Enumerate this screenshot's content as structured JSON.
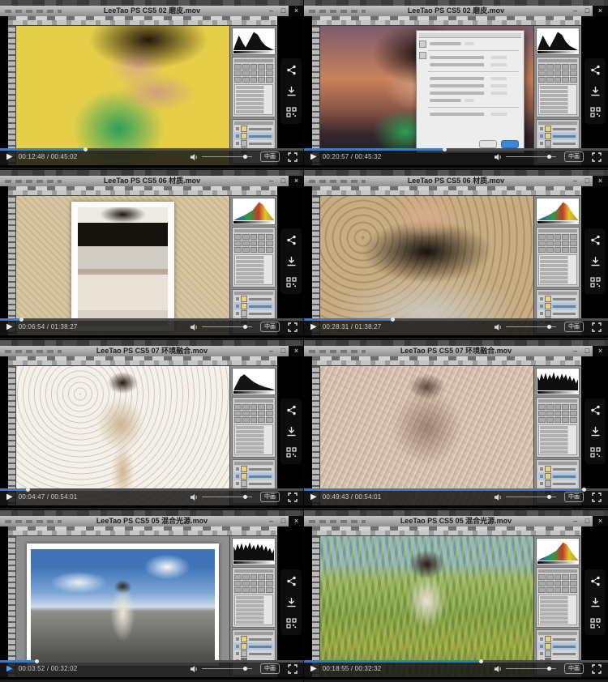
{
  "page": {
    "background": "#121212"
  },
  "player": {
    "accent_color": "#2f7fd6",
    "quality_label": "中画",
    "window_controls": {
      "minimize": "–",
      "maximize": "□",
      "close": "×"
    },
    "overlay_icons": [
      "share-icon",
      "download-icon",
      "qrcode-icon"
    ],
    "control_icons": [
      "play-icon",
      "volume-icon",
      "fullscreen-icon"
    ]
  },
  "cells": [
    {
      "title": "LeeTao PS CS5 02 磨皮.mov",
      "time_text": "00:12:48 / 00:45:02",
      "played_percent": 28,
      "histogram": "dark-peaks",
      "photo": "c1",
      "has_dialog": false
    },
    {
      "title": "LeeTao PS CS5 02 磨皮.mov",
      "time_text": "00:20:57 / 00:45:32",
      "played_percent": 46,
      "histogram": "dark-peaks",
      "photo": "c2",
      "has_dialog": true
    },
    {
      "title": "LeeTao PS CS5 06 材质.mov",
      "time_text": "00:06:54 / 01:38:27",
      "played_percent": 7,
      "histogram": "color-ramp",
      "photo": "c3",
      "has_dialog": false
    },
    {
      "title": "LeeTao PS CS5 06 材质.mov",
      "time_text": "00:28:31 / 01:38:27",
      "played_percent": 29,
      "histogram": "color-ramp",
      "photo": "c4",
      "has_dialog": false
    },
    {
      "title": "LeeTao PS CS5 07 环境融合.mov",
      "time_text": "00:04:47 / 00:54:01",
      "played_percent": 9,
      "histogram": "dark-mound",
      "photo": "c5",
      "has_dialog": false
    },
    {
      "title": "LeeTao PS CS5 07 环境融合.mov",
      "time_text": "00:49:43 / 00:54:01",
      "played_percent": 92,
      "histogram": "dark-comb",
      "photo": "c6",
      "has_dialog": false
    },
    {
      "title": "LeeTao PS CS5 05 混合光源.mov",
      "time_text": "00:03:52 / 00:32:02",
      "played_percent": 12,
      "histogram": "dark-comb",
      "photo": "c7",
      "has_dialog": false,
      "play_button_color": "#4da3ff"
    },
    {
      "title": "LeeTao PS CS5 05 混合光源.mov",
      "time_text": "00:18:55 / 00:32:32",
      "played_percent": 58,
      "histogram": "color-ramp",
      "photo": "c8",
      "has_dialog": false
    }
  ]
}
